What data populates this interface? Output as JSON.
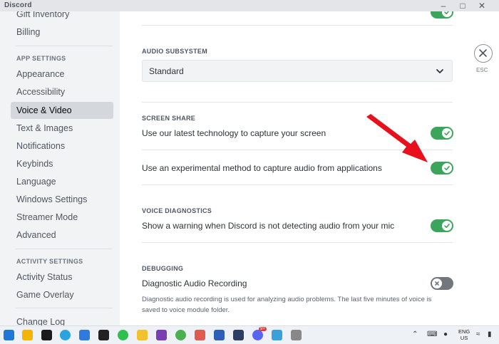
{
  "window": {
    "title": "Discord",
    "controls": [
      "minimize",
      "maximize",
      "close"
    ]
  },
  "sidebar": {
    "items_top": [
      "Gift Inventory",
      "Billing"
    ],
    "app_settings_header": "APP SETTINGS",
    "app_settings_items": [
      "Appearance",
      "Accessibility",
      "Voice & Video",
      "Text & Images",
      "Notifications",
      "Keybinds",
      "Language",
      "Windows Settings",
      "Streamer Mode",
      "Advanced"
    ],
    "active_item": "Voice & Video",
    "activity_settings_header": "ACTIVITY SETTINGS",
    "activity_items": [
      "Activity Status",
      "Game Overlay"
    ],
    "bottom_item": "Change Log"
  },
  "main": {
    "audio_subsystem": {
      "title": "AUDIO SUBSYSTEM",
      "value": "Standard"
    },
    "screen_share": {
      "title": "SCREEN SHARE",
      "rows": [
        {
          "label": "Use our latest technology to capture your screen",
          "enabled": true
        },
        {
          "label": "Use an experimental method to capture audio from applications",
          "enabled": true
        }
      ]
    },
    "voice_diagnostics": {
      "title": "VOICE DIAGNOSTICS",
      "label": "Show a warning when Discord is not detecting audio from your mic",
      "enabled": true
    },
    "debugging": {
      "title": "DEBUGGING",
      "label": "Diagnostic Audio Recording",
      "enabled": false,
      "note": "Diagnostic audio recording is used for analyzing audio problems. The last five minutes of voice is saved to voice module folder."
    },
    "esc": {
      "label": "ESC"
    }
  },
  "colors": {
    "toggle_on": "#3ba55c",
    "toggle_off": "#72767d",
    "annotation_arrow": "#e8101c",
    "sidebar_bg": "#f2f3f5"
  },
  "taskbar": {
    "lang": "ENG",
    "region": "US",
    "apps": [
      "start-icon",
      "sticky-notes-icon",
      "terminal-icon",
      "telegram-icon",
      "phone-icon",
      "media-icon",
      "whatsapp-icon",
      "file-explorer-icon",
      "onenote-icon",
      "chrome-icon",
      "photos-icon",
      "word-icon",
      "paint-icon",
      "discord-icon",
      "notepad-icon",
      "snipping-icon"
    ],
    "discord_badge": "9+"
  }
}
